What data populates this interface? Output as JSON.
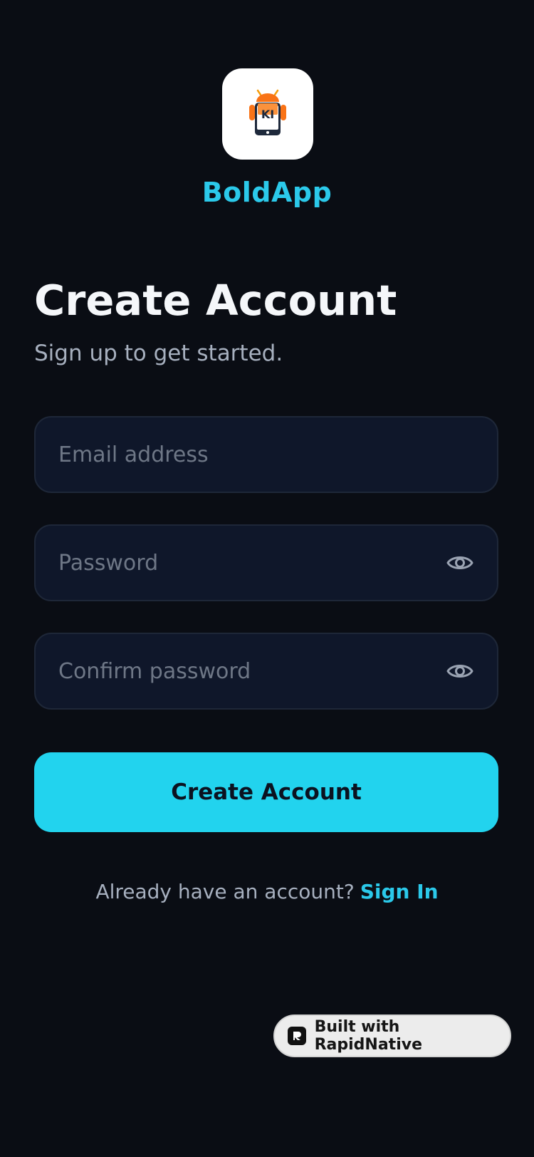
{
  "brand": {
    "app_name": "BoldApp",
    "logo_icon": "android-robot-phone-icon",
    "logo_text": "KI",
    "accent_color": "#22d3ee"
  },
  "header": {
    "title": "Create Account",
    "subtitle": "Sign up to get started."
  },
  "form": {
    "email_placeholder": "Email address",
    "password_placeholder": "Password",
    "confirm_placeholder": "Confirm password",
    "visibility_icon": "eye-icon",
    "submit_label": "Create Account"
  },
  "footer": {
    "prompt": "Already have an account?",
    "link_label": "Sign In"
  },
  "badge": {
    "icon": "rapidnative-logo-icon",
    "label": "Built with RapidNative"
  }
}
